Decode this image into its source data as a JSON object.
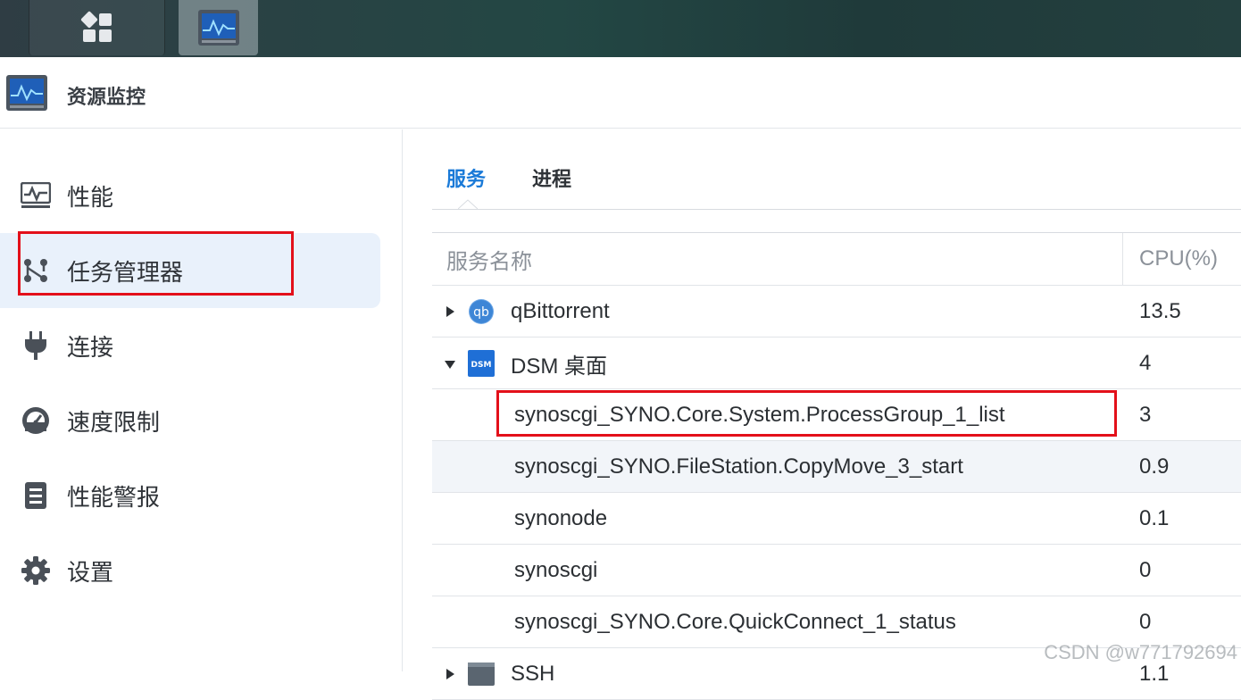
{
  "window": {
    "title": "资源监控"
  },
  "taskbar": {
    "items": [
      "main-menu-icon",
      "resource-monitor-icon"
    ]
  },
  "sidebar": {
    "items": [
      {
        "label": "性能",
        "icon": "performance-chart-icon"
      },
      {
        "label": "任务管理器",
        "icon": "task-manager-icon",
        "active": true
      },
      {
        "label": "连接",
        "icon": "plug-icon"
      },
      {
        "label": "速度限制",
        "icon": "speedometer-icon"
      },
      {
        "label": "性能警报",
        "icon": "alert-list-icon"
      },
      {
        "label": "设置",
        "icon": "gear-icon"
      }
    ]
  },
  "tabs": [
    {
      "label": "服务",
      "active": true
    },
    {
      "label": "进程",
      "active": false
    }
  ],
  "table": {
    "headers": {
      "name": "服务名称",
      "cpu": "CPU(%)"
    },
    "rows": [
      {
        "name": "qBittorrent",
        "cpu": "13.5",
        "icon": "qbittorrent-icon",
        "expander": "collapsed"
      },
      {
        "name": "DSM 桌面",
        "cpu": "4",
        "icon": "dsm-icon",
        "expander": "expanded"
      },
      {
        "name": "synoscgi_SYNO.Core.System.ProcessGroup_1_list",
        "cpu": "3"
      },
      {
        "name": "synoscgi_SYNO.FileStation.CopyMove_3_start",
        "cpu": "0.9"
      },
      {
        "name": "synonode",
        "cpu": "0.1"
      },
      {
        "name": "synoscgi",
        "cpu": "0"
      },
      {
        "name": "synoscgi_SYNO.Core.QuickConnect_1_status",
        "cpu": "0"
      },
      {
        "name": "SSH",
        "cpu": "1.1",
        "icon": "terminal-icon",
        "expander": "collapsed"
      }
    ]
  },
  "watermark": "CSDN @w771792694",
  "colors": {
    "accent": "#1a7ad8",
    "highlight": "#e3101a",
    "active_bg": "#e9f1fb"
  }
}
